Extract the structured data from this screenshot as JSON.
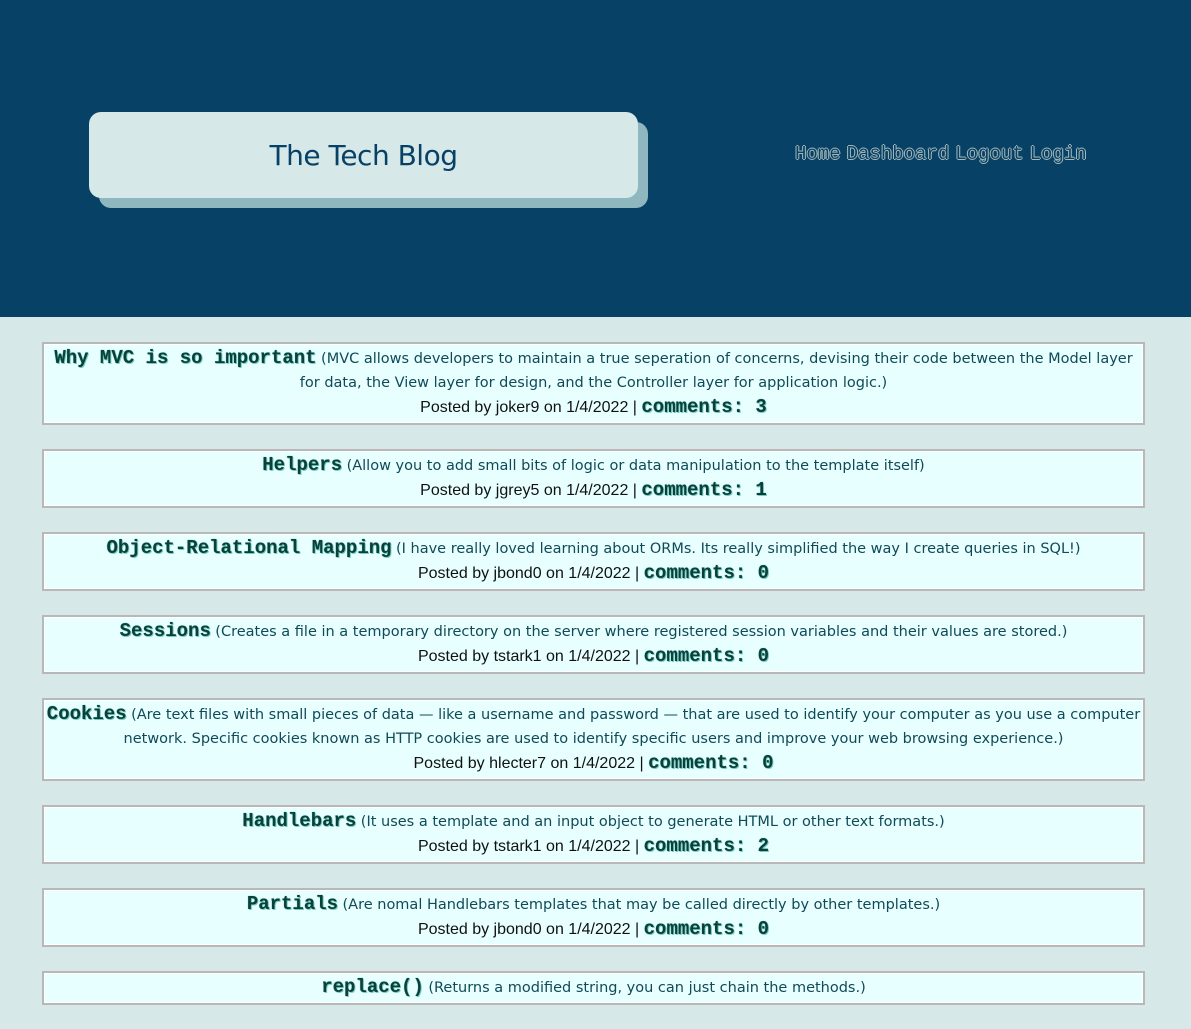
{
  "header": {
    "site_title": "The Tech Blog",
    "nav": [
      {
        "label": "Home"
      },
      {
        "label": "Dashboard"
      },
      {
        "label": "Logout"
      },
      {
        "label": "Login"
      }
    ]
  },
  "posts": [
    {
      "title": "Why MVC is so important",
      "body": "(MVC allows developers to maintain a true seperation of concerns, devising their code between the Model layer for data, the View layer for design, and the Controller layer for application logic.)",
      "author": "joker9",
      "date": "1/4/2022",
      "comments": "comments: 3"
    },
    {
      "title": "Helpers",
      "body": "(Allow you to add small bits of logic or data manipulation to the template itself)",
      "author": "jgrey5",
      "date": "1/4/2022",
      "comments": "comments: 1"
    },
    {
      "title": "Object-Relational Mapping",
      "body": "(I have really loved learning about ORMs. Its really simplified the way I create queries in SQL!)",
      "author": "jbond0",
      "date": "1/4/2022",
      "comments": "comments: 0"
    },
    {
      "title": "Sessions",
      "body": "(Creates a file in a temporary directory on the server where registered session variables and their values are stored.)",
      "author": "tstark1",
      "date": "1/4/2022",
      "comments": "comments: 0"
    },
    {
      "title": "Cookies",
      "body": "(Are text files with small pieces of data — like a username and password — that are used to identify your computer as you use a computer network. Specific cookies known as HTTP cookies are used to identify specific users and improve your web browsing experience.)",
      "author": "hlecter7",
      "date": "1/4/2022",
      "comments": "comments: 0"
    },
    {
      "title": "Handlebars",
      "body": "(It uses a template and an input object to generate HTML or other text formats.)",
      "author": "tstark1",
      "date": "1/4/2022",
      "comments": "comments: 2"
    },
    {
      "title": "Partials",
      "body": "(Are nomal Handlebars templates that may be called directly by other templates.)",
      "author": "jbond0",
      "date": "1/4/2022",
      "comments": "comments: 0"
    },
    {
      "title": "replace()",
      "body": "(Returns a modified string, you can just chain the methods.)",
      "author": "",
      "date": "",
      "comments": ""
    }
  ],
  "labels": {
    "posted_by": "Posted by",
    "on": "on",
    "separator": "|"
  },
  "colors": {
    "header_bg": "#084166",
    "page_bg": "#d6e8e8",
    "post_bg": "#e8ffff",
    "title_text": "#084166"
  }
}
